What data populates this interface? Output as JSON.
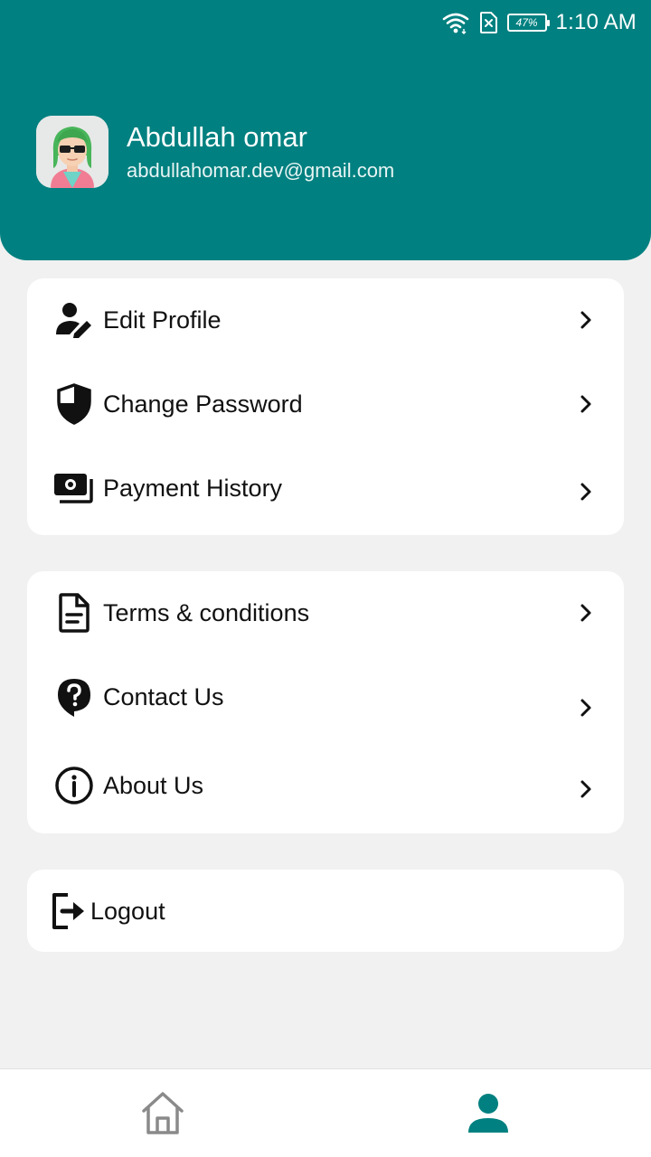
{
  "status_bar": {
    "battery": "47%",
    "time": "1:10 AM",
    "icons": [
      "wifi-icon",
      "no-sim-icon",
      "battery-icon"
    ]
  },
  "profile": {
    "name": "Abdullah omar",
    "email": "abdullahomar.dev@gmail.com"
  },
  "account_menu": [
    {
      "label": "Edit Profile",
      "icon": "edit-user-icon"
    },
    {
      "label": "Change Password",
      "icon": "shield-icon"
    },
    {
      "label": "Payment History",
      "icon": "money-icon"
    }
  ],
  "info_menu": [
    {
      "label": "Terms & conditions",
      "icon": "document-icon"
    },
    {
      "label": "Contact Us",
      "icon": "help-icon"
    },
    {
      "label": "About Us",
      "icon": "info-icon"
    }
  ],
  "logout": {
    "label": "Logout",
    "icon": "logout-icon"
  },
  "bottom_nav": [
    {
      "name": "home",
      "icon": "home-icon",
      "active": false
    },
    {
      "name": "profile",
      "icon": "person-icon",
      "active": true
    }
  ],
  "colors": {
    "primary": "#008080",
    "inactive": "#8a8a8a",
    "background": "#f1f1f1"
  }
}
